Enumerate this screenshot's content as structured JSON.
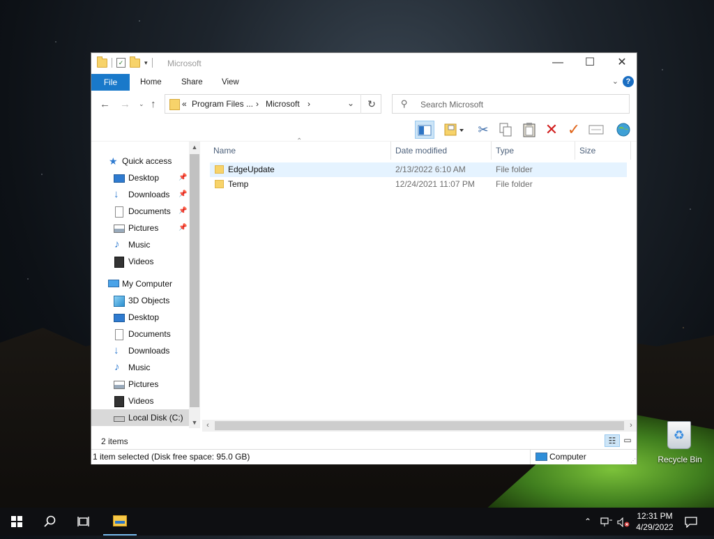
{
  "window": {
    "title": "Microsoft",
    "minimize": "—",
    "maximize": "☐",
    "close": "✕"
  },
  "ribbon": {
    "file": "File",
    "tabs": [
      "Home",
      "Share",
      "View"
    ],
    "help": "?"
  },
  "address": {
    "overflow": "«",
    "segments": [
      "Program Files ...",
      "Microsoft"
    ],
    "separator": "›"
  },
  "search": {
    "placeholder": "Search Microsoft"
  },
  "nav": {
    "quick_access": "Quick access",
    "quick_items": [
      "Desktop",
      "Downloads",
      "Documents",
      "Pictures",
      "Music",
      "Videos"
    ],
    "this_pc": "My Computer",
    "pc_items": [
      "3D Objects",
      "Desktop",
      "Documents",
      "Downloads",
      "Music",
      "Pictures",
      "Videos",
      "Local Disk (C:)"
    ]
  },
  "columns": {
    "name": "Name",
    "date": "Date modified",
    "type": "Type",
    "size": "Size"
  },
  "files": [
    {
      "name": "EdgeUpdate",
      "date": "2/13/2022 6:10 AM",
      "type": "File folder",
      "size": ""
    },
    {
      "name": "Temp",
      "date": "12/24/2021 11:07 PM",
      "type": "File folder",
      "size": ""
    }
  ],
  "info": {
    "count": "2 items"
  },
  "status": {
    "text": "1 item selected (Disk free space: 95.0 GB)",
    "location": "Computer"
  },
  "desktop": {
    "recycle_bin": "Recycle Bin"
  },
  "taskbar": {
    "time": "12:31 PM",
    "date": "4/29/2022"
  },
  "colors": {
    "accent": "#1979ca",
    "selection": "#e5f3ff",
    "taskbar": "#0e0f12"
  }
}
